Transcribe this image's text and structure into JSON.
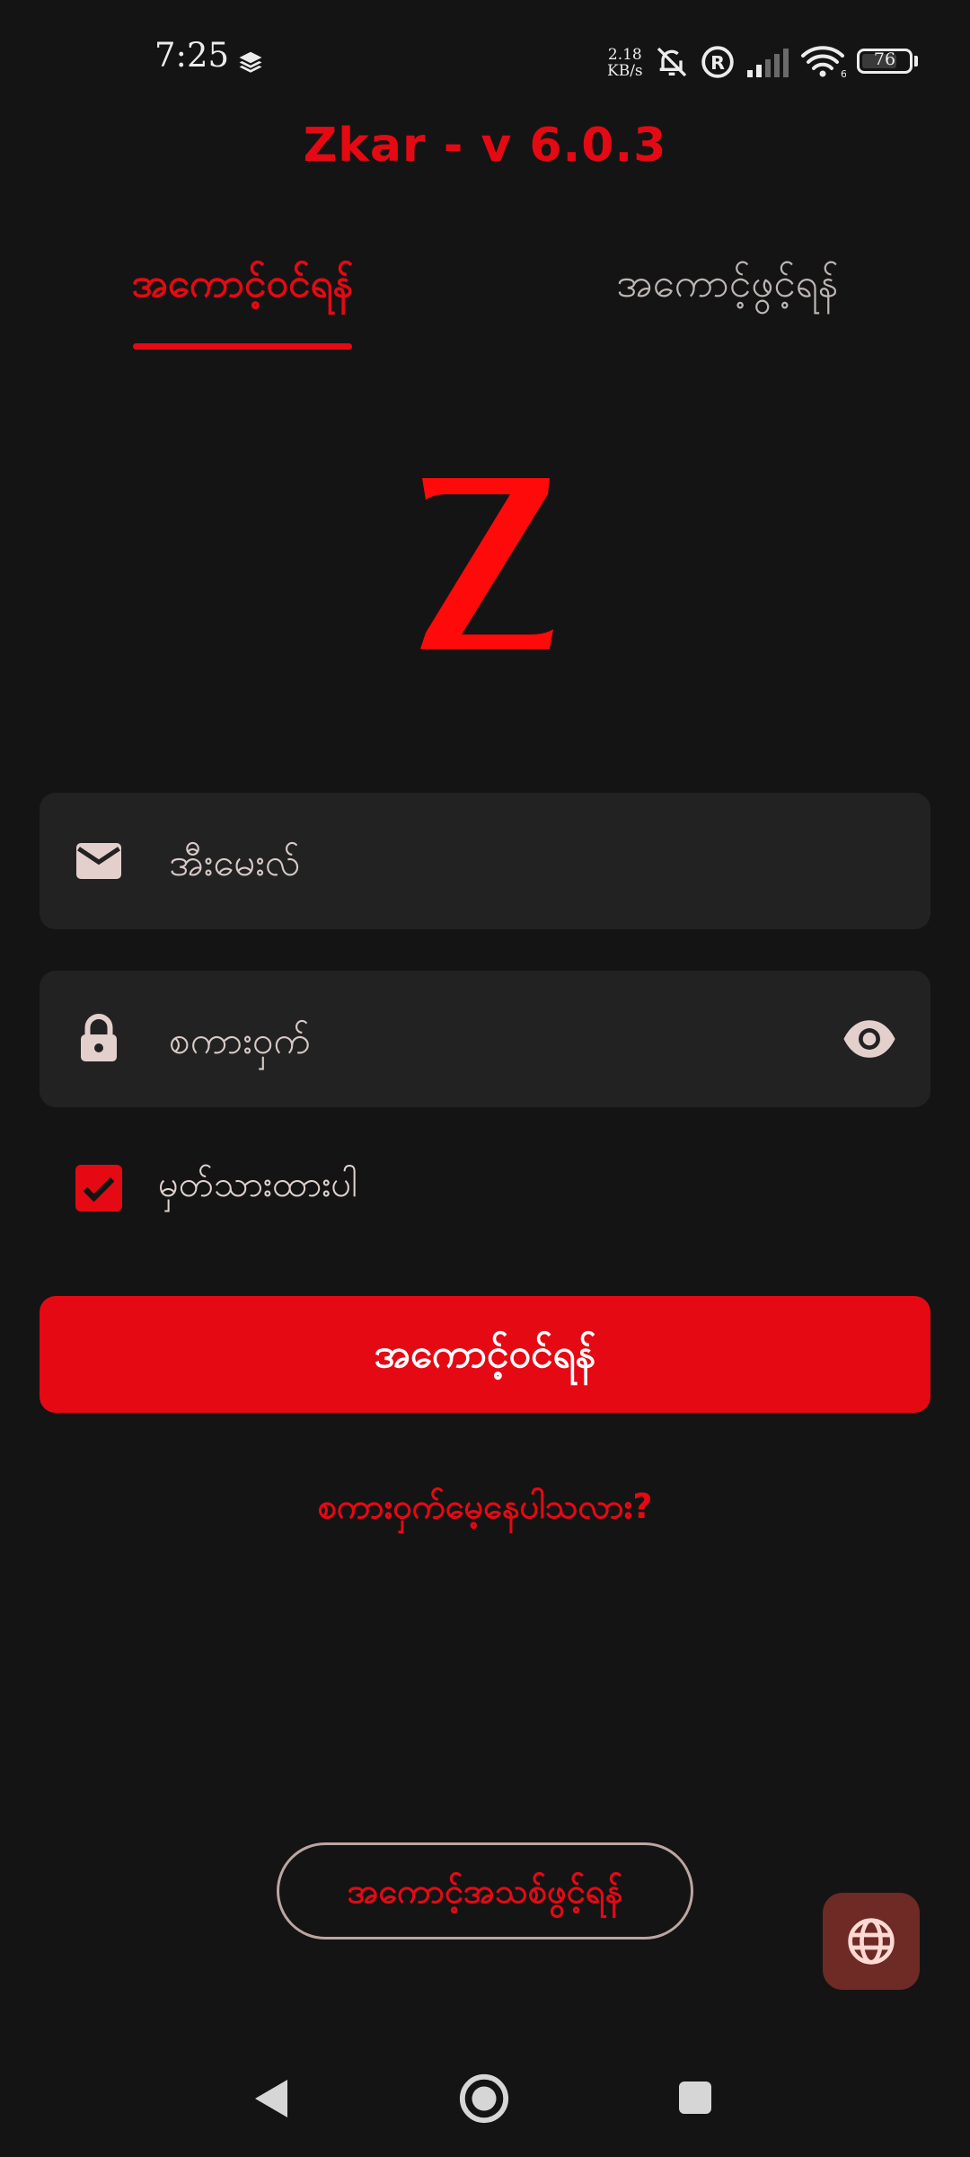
{
  "status_bar": {
    "time": "7:25",
    "net_speed_value": "2.18",
    "net_speed_unit": "KB/s",
    "battery": "76",
    "battery_level": 0.76,
    "icons": [
      "layers-icon",
      "bell-muted-icon",
      "registered-icon",
      "signal-icon",
      "wifi-icon",
      "battery-icon"
    ]
  },
  "app": {
    "title": "Zkar - v 6.0.3",
    "logo_letter": "Z"
  },
  "tabs": [
    {
      "label": "အကောင့်ဝင်ရန်",
      "active": true
    },
    {
      "label": "အကောင့်ဖွင့်ရန်",
      "active": false
    }
  ],
  "form": {
    "email": {
      "placeholder": "အီးမေးလ်",
      "value": "",
      "icon": "mail-icon"
    },
    "password": {
      "placeholder": "စကားဝှက်",
      "value": "",
      "icon": "lock-icon",
      "toggle_icon": "eye-icon"
    },
    "remember": {
      "label": "မှတ်သားထားပါ",
      "checked": true
    },
    "submit_label": "အကောင့်ဝင်ရန်",
    "forgot_label": "စကားဝှက်မေ့နေပါသလား?"
  },
  "create_account_label": "အကောင့်အသစ်ဖွင့်ရန်",
  "language_button_icon": "globe-icon",
  "colors": {
    "accent": "#e50914",
    "background": "#141414",
    "field_bg": "#222222",
    "fab_bg": "#6e2a24"
  },
  "nav": [
    "back-icon",
    "home-icon",
    "recents-icon"
  ]
}
